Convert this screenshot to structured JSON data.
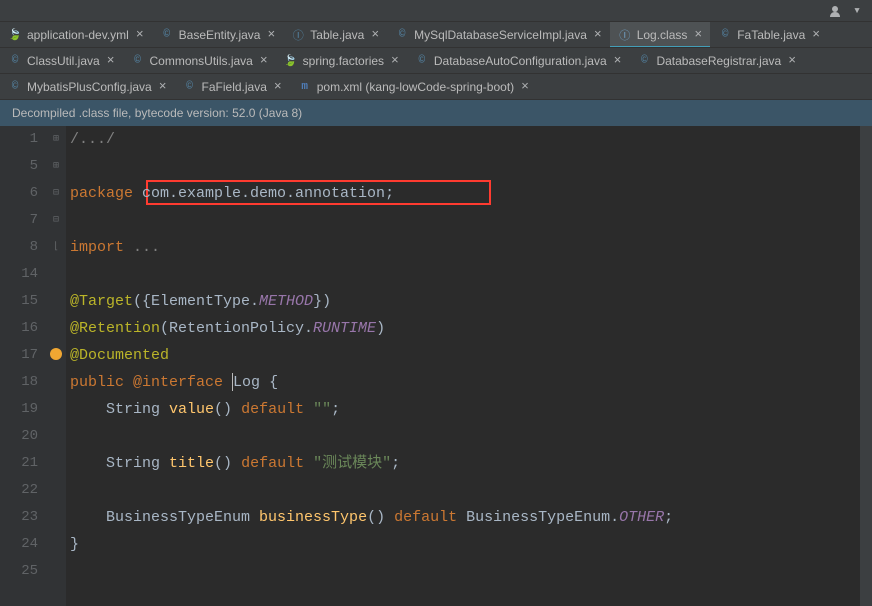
{
  "toolbar": {
    "avatar": "avatar",
    "dropdown": "▾"
  },
  "tabs": {
    "row1": [
      {
        "label": "application-dev.yml",
        "icon": "🍃",
        "active": false,
        "iconClass": "icon-yml"
      },
      {
        "label": "BaseEntity.java",
        "icon": "©",
        "active": false,
        "iconClass": "icon-java"
      },
      {
        "label": "Table.java",
        "icon": "Ⓘ",
        "active": false,
        "iconClass": "icon-java"
      },
      {
        "label": "MySqlDatabaseServiceImpl.java",
        "icon": "©",
        "active": false,
        "iconClass": "icon-java"
      },
      {
        "label": "Log.class",
        "icon": "Ⓘ",
        "active": true,
        "iconClass": "icon-cls"
      },
      {
        "label": "FaTable.java",
        "icon": "©",
        "active": false,
        "iconClass": "icon-java"
      }
    ],
    "row2": [
      {
        "label": "ClassUtil.java",
        "icon": "©",
        "active": false,
        "iconClass": "icon-java"
      },
      {
        "label": "CommonsUtils.java",
        "icon": "©",
        "active": false,
        "iconClass": "icon-java"
      },
      {
        "label": "spring.factories",
        "icon": "🍃",
        "active": false,
        "iconClass": "icon-factories"
      },
      {
        "label": "DatabaseAutoConfiguration.java",
        "icon": "©",
        "active": false,
        "iconClass": "icon-java"
      },
      {
        "label": "DatabaseRegistrar.java",
        "icon": "©",
        "active": false,
        "iconClass": "icon-java"
      }
    ],
    "row3": [
      {
        "label": "MybatisPlusConfig.java",
        "icon": "©",
        "active": false,
        "iconClass": "icon-java"
      },
      {
        "label": "FaField.java",
        "icon": "©",
        "active": false,
        "iconClass": "icon-java"
      },
      {
        "label": "pom.xml (kang-lowCode-spring-boot)",
        "icon": "m",
        "active": false,
        "iconClass": "icon-maven"
      }
    ]
  },
  "info_bar": "Decompiled .class file, bytecode version: 52.0 (Java 8)",
  "line_numbers": [
    "1",
    "5",
    "6",
    "7",
    "8",
    "14",
    "15",
    "16",
    "17",
    "18",
    "19",
    "20",
    "21",
    "22",
    "23",
    "24",
    "25"
  ],
  "fold_marks": [
    "⊞",
    "",
    "",
    "",
    "⊞",
    "",
    "⊟",
    "",
    "⊟",
    "",
    "",
    "",
    "",
    "",
    "",
    "⌊",
    ""
  ],
  "code": {
    "l1_comment": "/.../",
    "l6_kw": "package ",
    "l6_pkg": "com.example.demo.annotation",
    "l8_kw": "import ",
    "l8_rest": "...",
    "l15_ann": "@Target",
    "l15_rest1": "({ElementType.",
    "l15_method": "METHOD",
    "l15_rest2": "})",
    "l16_ann": "@Retention",
    "l16_rest1": "(RetentionPolicy.",
    "l16_runtime": "RUNTIME",
    "l16_rest2": ")",
    "l17_ann": "@Documented",
    "l18_kw1": "public ",
    "l18_ann": "@interface ",
    "l18_name": "Log",
    "l18_brace": " {",
    "l19_type": "String ",
    "l19_method": "value",
    "l19_rest": "() ",
    "l19_def": "default ",
    "l19_str": "\"\"",
    "l21_type": "String ",
    "l21_method": "title",
    "l21_rest": "() ",
    "l21_def": "default ",
    "l21_str": "\"测试模块\"",
    "l23_type": "BusinessTypeEnum ",
    "l23_method": "businessType",
    "l23_rest": "() ",
    "l23_def": "default ",
    "l23_enum1": "BusinessTypeEnum.",
    "l23_enum2": "OTHER",
    "l24_brace": "}",
    "semicolon": ";"
  }
}
